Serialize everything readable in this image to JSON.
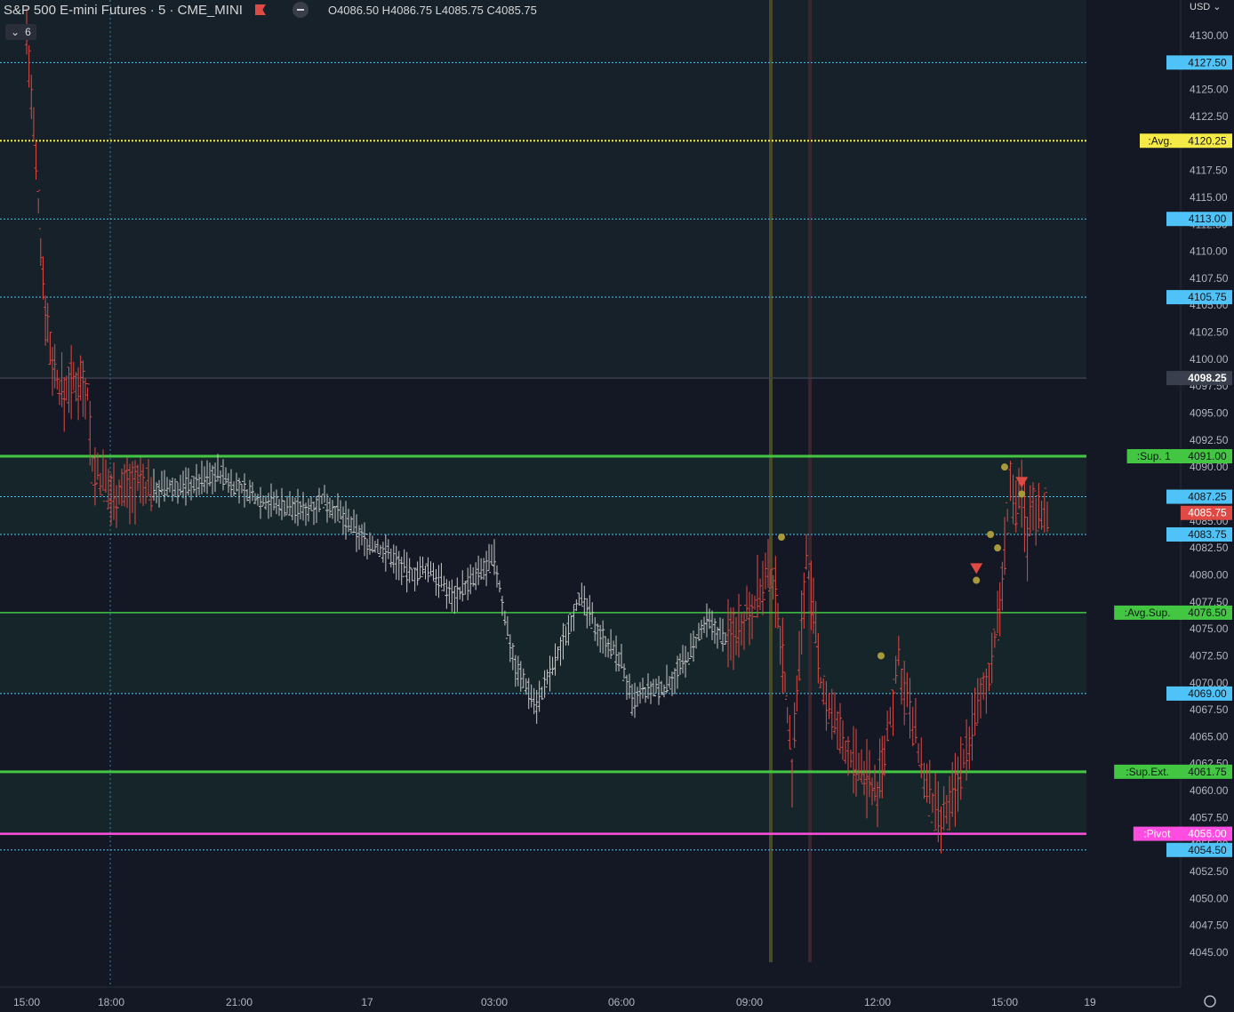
{
  "header": {
    "title": "S&P 500 E-mini Futures · 5 · CME_MINI",
    "ohlc": "O4086.50  H4086.75  L4085.75  C4085.75",
    "indicator_count": "6",
    "currency": "USD"
  },
  "colors": {
    "background": "#141824",
    "panel": "#16222a",
    "up_bars": "#c8c8c8",
    "down_bars": "#e04a45",
    "blue_level": "#4fc3f7",
    "green_level": "#43c743",
    "pivot": "#ff4de1",
    "avg": "#f5ea46",
    "current_price": "#e04a45"
  },
  "chart_data": {
    "type": "ohlc",
    "symbol": "ES",
    "interval": "5",
    "x_tick_labels": [
      "15:00",
      "18:00",
      "21:00",
      "17",
      "03:00",
      "06:00",
      "09:00",
      "12:00",
      "15:00",
      "19"
    ],
    "y_tick_labels": [
      "4130.00",
      "4127.50",
      "4125.00",
      "4122.50",
      "4120.00",
      "4117.50",
      "4115.00",
      "4112.50",
      "4110.00",
      "4107.50",
      "4105.00",
      "4102.50",
      "4100.00",
      "4097.50",
      "4095.00",
      "4092.50",
      "4090.00",
      "4087.50",
      "4085.00",
      "4082.50",
      "4080.00",
      "4077.50",
      "4075.00",
      "4072.50",
      "4070.00",
      "4067.50",
      "4065.00",
      "4062.50",
      "4060.00",
      "4057.50",
      "4055.00",
      "4052.50",
      "4050.00",
      "4047.50",
      "4045.00"
    ],
    "ylim": [
      4044,
      4131.5
    ],
    "levels": [
      {
        "label": "",
        "price": 4127.5,
        "style": "blue"
      },
      {
        "label": ":Avg.",
        "price": 4120.25,
        "style": "avg"
      },
      {
        "label": "",
        "price": 4113.0,
        "style": "blue"
      },
      {
        "label": "",
        "price": 4105.75,
        "style": "blue"
      },
      {
        "label": "",
        "price": 4098.25,
        "style": "gray"
      },
      {
        "label": ":Sup. 1",
        "price": 4091.0,
        "style": "green"
      },
      {
        "label": "",
        "price": 4087.25,
        "style": "blue"
      },
      {
        "label": "",
        "price": 4083.75,
        "style": "blue"
      },
      {
        "label": ":Avg.Sup.",
        "price": 4076.5,
        "style": "green"
      },
      {
        "label": "",
        "price": 4069.0,
        "style": "blue"
      },
      {
        "label": ":Sup.Ext.",
        "price": 4061.75,
        "style": "green"
      },
      {
        "label": ":Pivot",
        "price": 4056.0,
        "style": "pivot"
      },
      {
        "label": "",
        "price": 4054.5,
        "style": "blue"
      }
    ],
    "current_price": 4085.75,
    "path": [
      [
        "15:00",
        4130.5
      ],
      [
        "15:10",
        4124.0
      ],
      [
        "15:20",
        4117.5
      ],
      [
        "15:30",
        4110.5
      ],
      [
        "15:40",
        4105.0
      ],
      [
        "15:50",
        4101.0
      ],
      [
        "16:00",
        4099.0
      ],
      [
        "16:10",
        4097.5
      ],
      [
        "16:20",
        4096.5
      ],
      [
        "16:30",
        4098.0
      ],
      [
        "16:40",
        4097.5
      ],
      [
        "16:50",
        4098.0
      ],
      [
        "17:00",
        4098.0
      ],
      [
        "17:10",
        4097.0
      ],
      [
        "17:20",
        4090.0
      ],
      [
        "18:00",
        4087.5
      ],
      [
        "18:30",
        4088.5
      ],
      [
        "19:00",
        4088.0
      ],
      [
        "19:30",
        4088.0
      ],
      [
        "20:00",
        4088.5
      ],
      [
        "20:30",
        4089.5
      ],
      [
        "21:00",
        4088.0
      ],
      [
        "21:30",
        4087.0
      ],
      [
        "22:00",
        4086.5
      ],
      [
        "22:30",
        4086.0
      ],
      [
        "23:00",
        4087.0
      ],
      [
        "23:30",
        4085.0
      ],
      [
        "00:00",
        4083.0
      ],
      [
        "00:30",
        4082.0
      ],
      [
        "01:00",
        4080.0
      ],
      [
        "01:30",
        4080.5
      ],
      [
        "02:00",
        4078.0
      ],
      [
        "02:30",
        4079.5
      ],
      [
        "03:00",
        4081.5
      ],
      [
        "03:15",
        4076.0
      ],
      [
        "03:30",
        4071.5
      ],
      [
        "04:00",
        4068.0
      ],
      [
        "04:30",
        4072.5
      ],
      [
        "05:00",
        4078.0
      ],
      [
        "05:30",
        4074.5
      ],
      [
        "06:00",
        4072.0
      ],
      [
        "06:15",
        4068.0
      ],
      [
        "06:30",
        4069.0
      ],
      [
        "07:00",
        4069.5
      ],
      [
        "07:30",
        4072.0
      ],
      [
        "08:00",
        4075.5
      ],
      [
        "08:30",
        4074.0
      ],
      [
        "09:00",
        4077.0
      ],
      [
        "09:30",
        4080.0
      ],
      [
        "09:40",
        4077.0
      ],
      [
        "09:50",
        4070.0
      ],
      [
        "10:00",
        4062.0
      ],
      [
        "10:10",
        4072.0
      ],
      [
        "10:20",
        4082.0
      ],
      [
        "10:30",
        4076.0
      ],
      [
        "10:40",
        4070.0
      ],
      [
        "11:00",
        4066.0
      ],
      [
        "11:30",
        4062.0
      ],
      [
        "12:00",
        4060.0
      ],
      [
        "12:10",
        4063.5
      ],
      [
        "12:30",
        4072.0
      ],
      [
        "12:50",
        4066.0
      ],
      [
        "13:10",
        4060.0
      ],
      [
        "13:30",
        4056.5
      ],
      [
        "13:50",
        4060.0
      ],
      [
        "14:10",
        4065.0
      ],
      [
        "14:30",
        4069.0
      ],
      [
        "14:50",
        4075.0
      ],
      [
        "15:00",
        4082.0
      ],
      [
        "15:10",
        4089.0
      ],
      [
        "15:20",
        4085.0
      ],
      [
        "15:30",
        4088.0
      ],
      [
        "15:40",
        4083.0
      ],
      [
        "15:50",
        4087.0
      ],
      [
        "16:00",
        4085.5
      ],
      [
        "16:10",
        4086.5
      ],
      [
        "16:20",
        4085.75
      ]
    ],
    "markers": [
      {
        "type": "dot",
        "time": "09:45",
        "price": 4083.5
      },
      {
        "type": "dot",
        "time": "12:05",
        "price": 4072.5
      },
      {
        "type": "dot",
        "time": "14:20",
        "price": 4079.5
      },
      {
        "type": "dot",
        "time": "14:40",
        "price": 4083.75
      },
      {
        "type": "dot",
        "time": "14:50",
        "price": 4082.5
      },
      {
        "type": "dot",
        "time": "15:00",
        "price": 4090.0
      },
      {
        "type": "dot",
        "time": "15:30",
        "price": 4087.5
      },
      {
        "type": "down-arrow",
        "time": "14:20",
        "price": 4080.5
      },
      {
        "type": "down-arrow",
        "time": "15:30",
        "price": 4088.5
      }
    ]
  }
}
